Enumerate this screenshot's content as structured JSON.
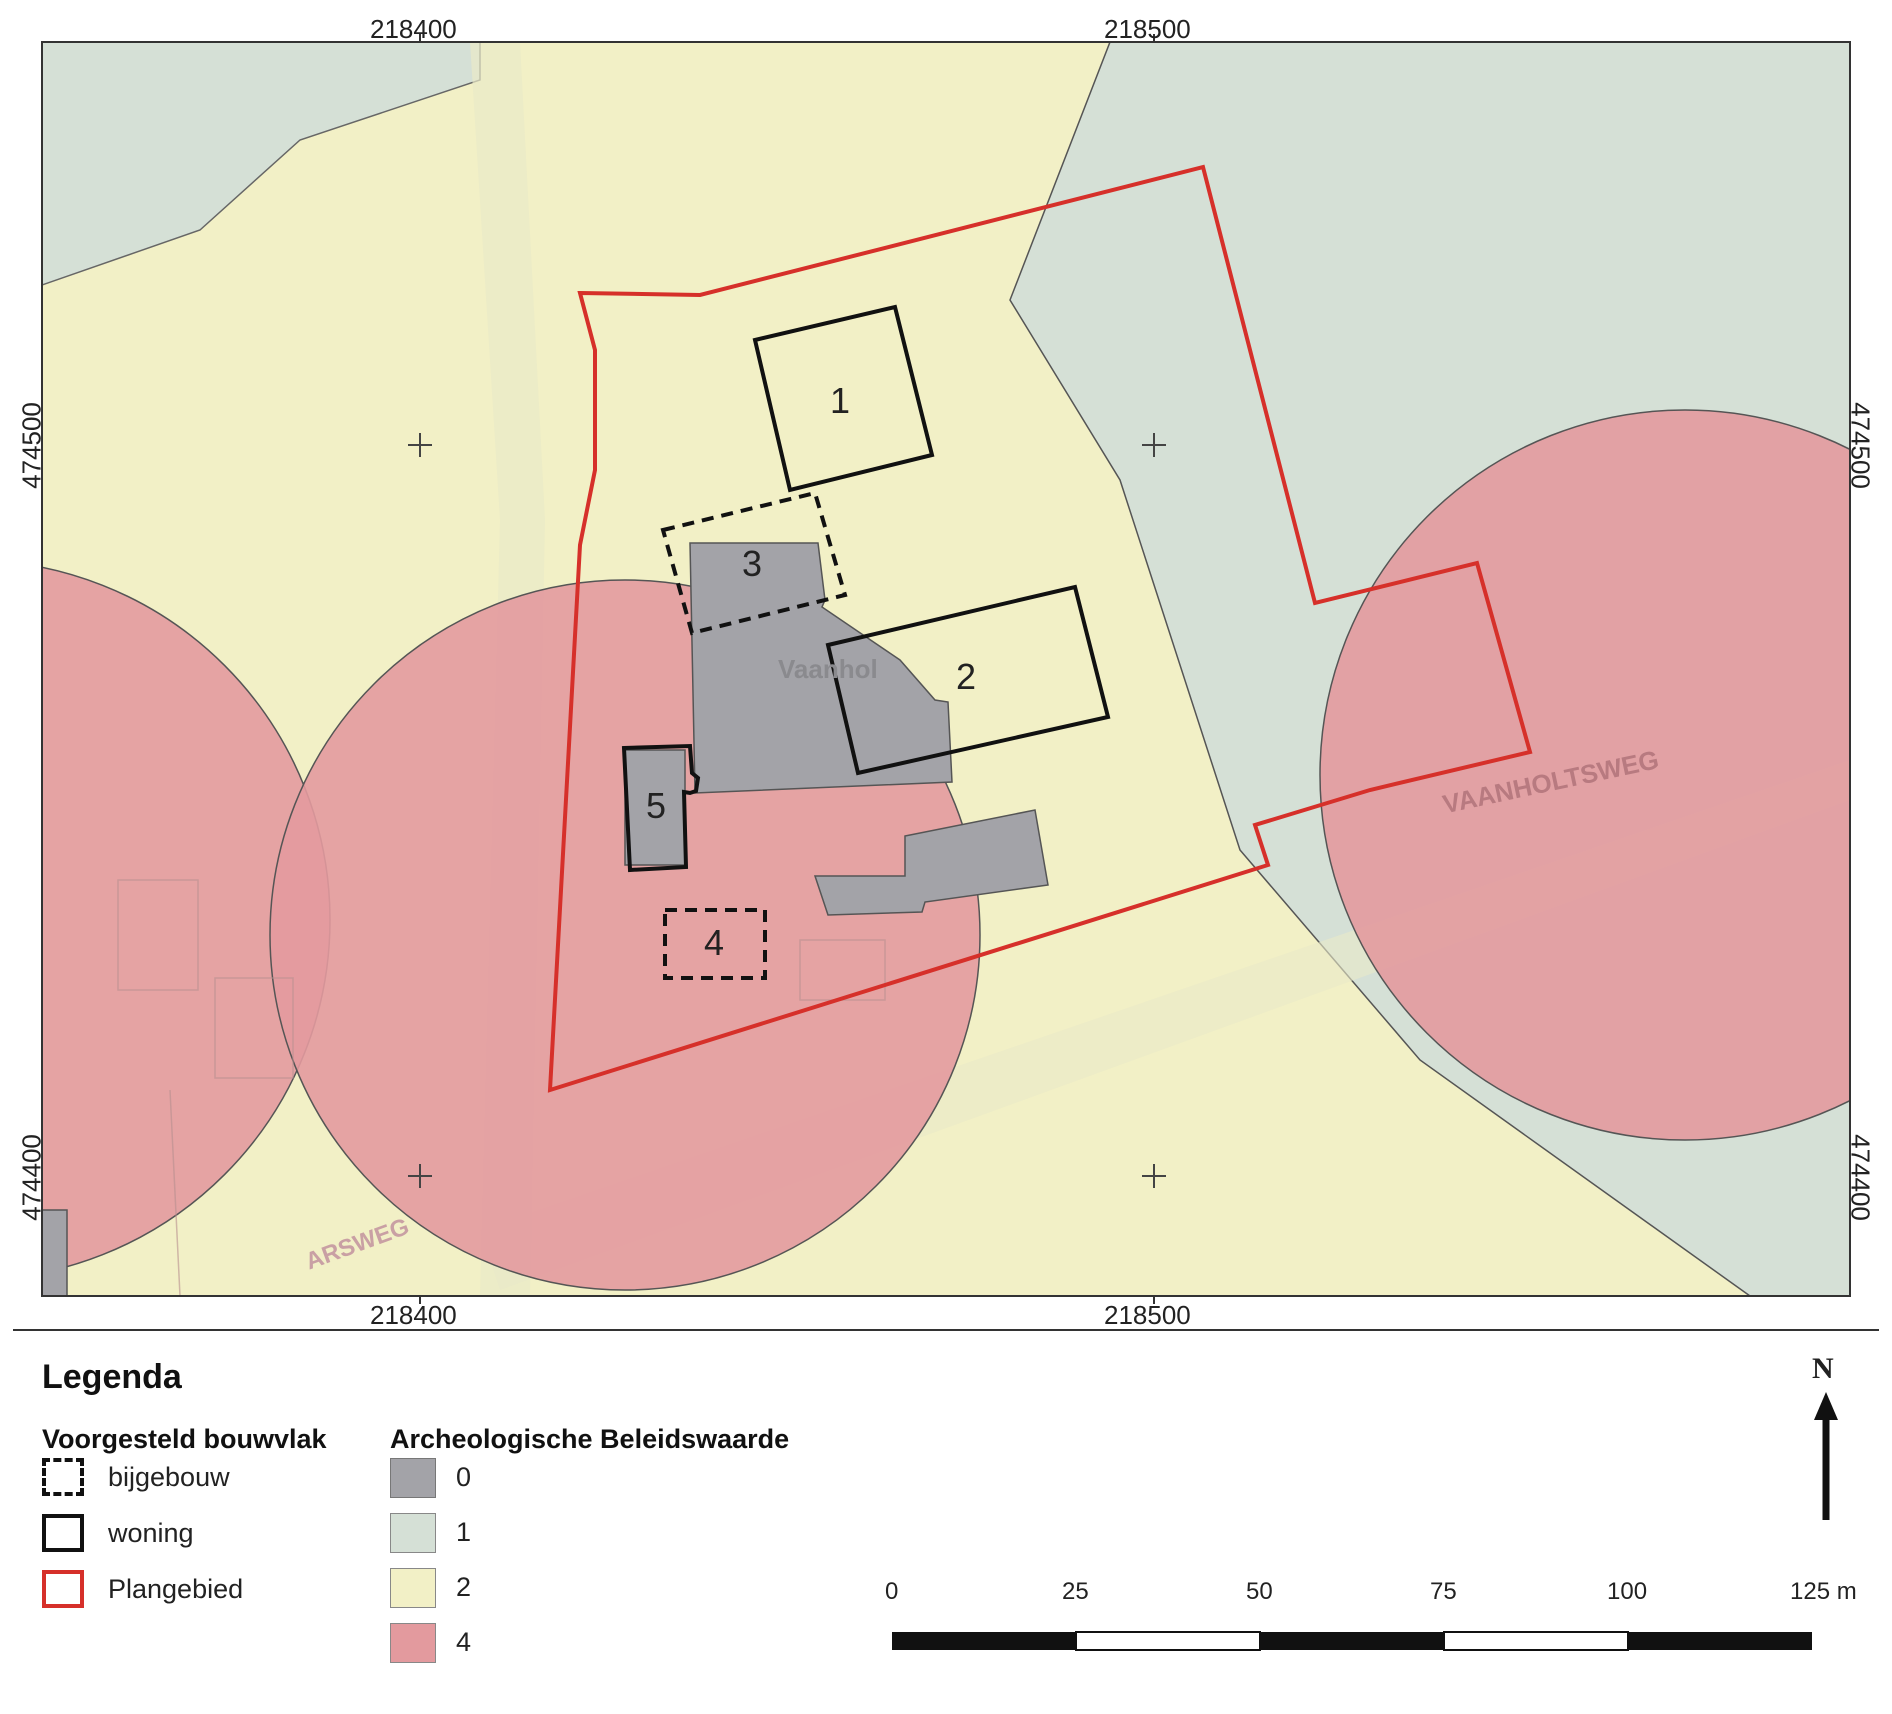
{
  "map": {
    "top_x_labels": [
      "218400",
      "218500"
    ],
    "bottom_x_labels": [
      "218400",
      "218500"
    ],
    "left_y_labels": [
      "474500",
      "474400"
    ],
    "right_y_labels": [
      "474500",
      "474400"
    ],
    "building_labels": [
      "1",
      "2",
      "3",
      "4",
      "5"
    ],
    "street_labels": [
      "VAANHOLTSWEG",
      "ARSWEG"
    ],
    "place_label": "Vaanhol"
  },
  "legend": {
    "title": "Legenda",
    "group1_title": "Voorgesteld bouwvlak",
    "group1_items": [
      {
        "label": "bijgebouw",
        "style": "dashed",
        "color": "#111111"
      },
      {
        "label": "woning",
        "style": "solid",
        "color": "#111111"
      },
      {
        "label": "Plangebied",
        "style": "solid",
        "color": "#d6302a"
      }
    ],
    "group2_title": "Archeologische Beleidswaarde",
    "group2_items": [
      {
        "label": "0",
        "color": "#a3a3a8"
      },
      {
        "label": "1",
        "color": "#d5e0d6"
      },
      {
        "label": "2",
        "color": "#f2f0c6"
      },
      {
        "label": "4",
        "color": "#e39a9e"
      }
    ]
  },
  "north_arrow": {
    "label": "N"
  },
  "scale_bar": {
    "labels": [
      "0",
      "25",
      "50",
      "75",
      "100",
      "125 m"
    ]
  }
}
